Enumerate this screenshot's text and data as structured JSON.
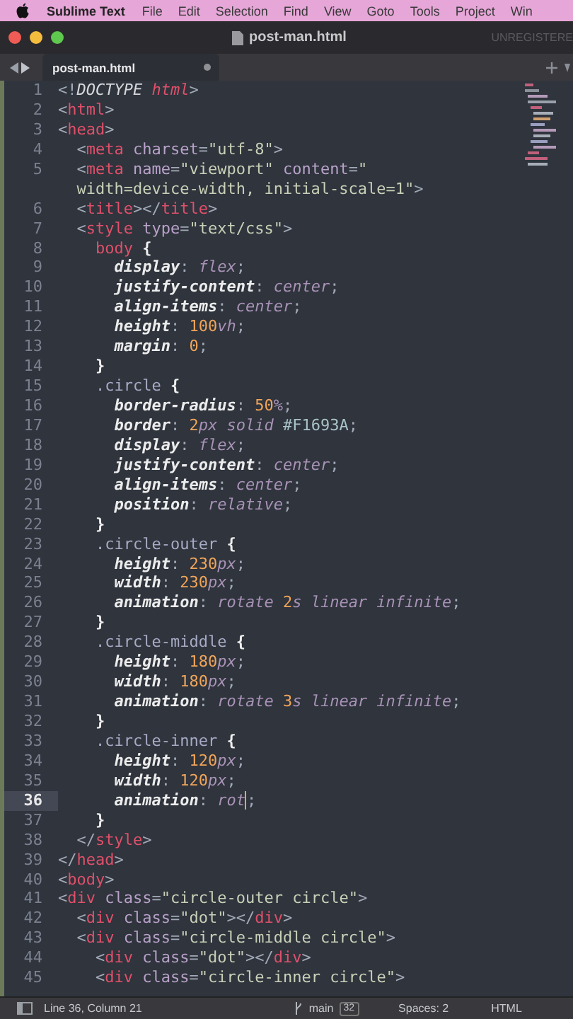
{
  "menu_bar": {
    "app": "Sublime Text",
    "items": [
      "File",
      "Edit",
      "Selection",
      "Find",
      "View",
      "Goto",
      "Tools",
      "Project",
      "Win"
    ]
  },
  "window": {
    "title": "post-man.html",
    "registration": "UNREGISTERE"
  },
  "tabs": [
    {
      "label": "post-man.html",
      "selected": true,
      "modified": true
    }
  ],
  "lines": [
    {
      "number": "1",
      "current": false,
      "tokens": [
        {
          "kind": "punct",
          "text": "<!"
        },
        {
          "kind": "doctype",
          "text": "DOCTYPE "
        },
        {
          "kind": "tag_italic",
          "text": "html"
        },
        {
          "kind": "punct",
          "text": ">"
        }
      ]
    },
    {
      "number": "2",
      "current": false,
      "tokens": [
        {
          "kind": "punct",
          "text": "<"
        },
        {
          "kind": "tag",
          "text": "html"
        },
        {
          "kind": "punct",
          "text": ">"
        }
      ]
    },
    {
      "number": "3",
      "current": false,
      "tokens": [
        {
          "kind": "punct",
          "text": "<"
        },
        {
          "kind": "tag",
          "text": "head"
        },
        {
          "kind": "punct",
          "text": ">"
        }
      ]
    },
    {
      "number": "4",
      "current": false,
      "tokens": [
        {
          "kind": "punct",
          "text": "  <"
        },
        {
          "kind": "tag",
          "text": "meta"
        },
        {
          "kind": "attr",
          "text": " charset"
        },
        {
          "kind": "punct",
          "text": "="
        },
        {
          "kind": "string",
          "text": "\"utf-8\""
        },
        {
          "kind": "punct",
          "text": ">"
        }
      ]
    },
    {
      "number": "5",
      "current": false,
      "tokens": [
        {
          "kind": "punct",
          "text": "  <"
        },
        {
          "kind": "tag",
          "text": "meta"
        },
        {
          "kind": "attr",
          "text": " name"
        },
        {
          "kind": "punct",
          "text": "="
        },
        {
          "kind": "string",
          "text": "\"viewport\""
        },
        {
          "kind": "attr",
          "text": " content"
        },
        {
          "kind": "punct",
          "text": "="
        },
        {
          "kind": "string",
          "text": "\""
        }
      ]
    },
    {
      "current": false,
      "tokens": [
        {
          "kind": "string",
          "text": "  width=device-width, initial-scale=1\""
        },
        {
          "kind": "punct",
          "text": ">"
        }
      ]
    },
    {
      "number": "6",
      "current": false,
      "tokens": [
        {
          "kind": "punct",
          "text": "  <"
        },
        {
          "kind": "tag",
          "text": "title"
        },
        {
          "kind": "punct",
          "text": "></"
        },
        {
          "kind": "tag",
          "text": "title"
        },
        {
          "kind": "punct",
          "text": ">"
        }
      ]
    },
    {
      "number": "7",
      "current": false,
      "tokens": [
        {
          "kind": "punct",
          "text": "  <"
        },
        {
          "kind": "tag",
          "text": "style"
        },
        {
          "kind": "attr",
          "text": " type"
        },
        {
          "kind": "punct",
          "text": "="
        },
        {
          "kind": "string",
          "text": "\"text/css\""
        },
        {
          "kind": "punct",
          "text": ">"
        }
      ]
    },
    {
      "number": "8",
      "current": false,
      "tokens": [
        {
          "kind": "tag",
          "text": "    body"
        },
        {
          "kind": "brace",
          "text": " {"
        }
      ]
    },
    {
      "number": "9",
      "current": false,
      "tokens": [
        {
          "kind": "property",
          "text": "      display"
        },
        {
          "kind": "punct",
          "text": ": "
        },
        {
          "kind": "value",
          "text": "flex"
        },
        {
          "kind": "punct",
          "text": ";"
        }
      ]
    },
    {
      "number": "10",
      "current": false,
      "tokens": [
        {
          "kind": "property",
          "text": "      justify-content"
        },
        {
          "kind": "punct",
          "text": ": "
        },
        {
          "kind": "value",
          "text": "center"
        },
        {
          "kind": "punct",
          "text": ";"
        }
      ]
    },
    {
      "number": "11",
      "current": false,
      "tokens": [
        {
          "kind": "property",
          "text": "      align-items"
        },
        {
          "kind": "punct",
          "text": ": "
        },
        {
          "kind": "value",
          "text": "center"
        },
        {
          "kind": "punct",
          "text": ";"
        }
      ]
    },
    {
      "number": "12",
      "current": false,
      "tokens": [
        {
          "kind": "property",
          "text": "      height"
        },
        {
          "kind": "punct",
          "text": ": "
        },
        {
          "kind": "number",
          "text": "100"
        },
        {
          "kind": "value",
          "text": "vh"
        },
        {
          "kind": "punct",
          "text": ";"
        }
      ]
    },
    {
      "number": "13",
      "current": false,
      "tokens": [
        {
          "kind": "property",
          "text": "      margin"
        },
        {
          "kind": "punct",
          "text": ": "
        },
        {
          "kind": "number",
          "text": "0"
        },
        {
          "kind": "punct",
          "text": ";"
        }
      ]
    },
    {
      "number": "14",
      "current": false,
      "tokens": [
        {
          "kind": "brace",
          "text": "    }"
        }
      ]
    },
    {
      "number": "15",
      "current": false,
      "tokens": [
        {
          "kind": "selector",
          "text": "    .circle"
        },
        {
          "kind": "brace",
          "text": " {"
        }
      ]
    },
    {
      "number": "16",
      "current": false,
      "tokens": [
        {
          "kind": "property",
          "text": "      border-radius"
        },
        {
          "kind": "punct",
          "text": ": "
        },
        {
          "kind": "number",
          "text": "50"
        },
        {
          "kind": "value",
          "text": "%"
        },
        {
          "kind": "punct",
          "text": ";"
        }
      ]
    },
    {
      "number": "17",
      "current": false,
      "tokens": [
        {
          "kind": "property",
          "text": "      border"
        },
        {
          "kind": "punct",
          "text": ": "
        },
        {
          "kind": "number",
          "text": "2"
        },
        {
          "kind": "value",
          "text": "px solid "
        },
        {
          "kind": "hex",
          "text": "#F1693A"
        },
        {
          "kind": "punct",
          "text": ";"
        }
      ]
    },
    {
      "number": "18",
      "current": false,
      "tokens": [
        {
          "kind": "property",
          "text": "      display"
        },
        {
          "kind": "punct",
          "text": ": "
        },
        {
          "kind": "value",
          "text": "flex"
        },
        {
          "kind": "punct",
          "text": ";"
        }
      ]
    },
    {
      "number": "19",
      "current": false,
      "tokens": [
        {
          "kind": "property",
          "text": "      justify-content"
        },
        {
          "kind": "punct",
          "text": ": "
        },
        {
          "kind": "value",
          "text": "center"
        },
        {
          "kind": "punct",
          "text": ";"
        }
      ]
    },
    {
      "number": "20",
      "current": false,
      "tokens": [
        {
          "kind": "property",
          "text": "      align-items"
        },
        {
          "kind": "punct",
          "text": ": "
        },
        {
          "kind": "value",
          "text": "center"
        },
        {
          "kind": "punct",
          "text": ";"
        }
      ]
    },
    {
      "number": "21",
      "current": false,
      "tokens": [
        {
          "kind": "property",
          "text": "      position"
        },
        {
          "kind": "punct",
          "text": ": "
        },
        {
          "kind": "value",
          "text": "relative"
        },
        {
          "kind": "punct",
          "text": ";"
        }
      ]
    },
    {
      "number": "22",
      "current": false,
      "tokens": [
        {
          "kind": "brace",
          "text": "    }"
        }
      ]
    },
    {
      "number": "23",
      "current": false,
      "tokens": [
        {
          "kind": "selector",
          "text": "    .circle-outer"
        },
        {
          "kind": "brace",
          "text": " {"
        }
      ]
    },
    {
      "number": "24",
      "current": false,
      "tokens": [
        {
          "kind": "property",
          "text": "      height"
        },
        {
          "kind": "punct",
          "text": ": "
        },
        {
          "kind": "number",
          "text": "230"
        },
        {
          "kind": "value",
          "text": "px"
        },
        {
          "kind": "punct",
          "text": ";"
        }
      ]
    },
    {
      "number": "25",
      "current": false,
      "tokens": [
        {
          "kind": "property",
          "text": "      width"
        },
        {
          "kind": "punct",
          "text": ": "
        },
        {
          "kind": "number",
          "text": "230"
        },
        {
          "kind": "value",
          "text": "px"
        },
        {
          "kind": "punct",
          "text": ";"
        }
      ]
    },
    {
      "number": "26",
      "current": false,
      "tokens": [
        {
          "kind": "property",
          "text": "      animation"
        },
        {
          "kind": "punct",
          "text": ": "
        },
        {
          "kind": "value",
          "text": "rotate "
        },
        {
          "kind": "number",
          "text": "2"
        },
        {
          "kind": "value",
          "text": "s linear infinite"
        },
        {
          "kind": "punct",
          "text": ";"
        }
      ]
    },
    {
      "number": "27",
      "current": false,
      "tokens": [
        {
          "kind": "brace",
          "text": "    }"
        }
      ]
    },
    {
      "number": "28",
      "current": false,
      "tokens": [
        {
          "kind": "selector",
          "text": "    .circle-middle"
        },
        {
          "kind": "brace",
          "text": " {"
        }
      ]
    },
    {
      "number": "29",
      "current": false,
      "tokens": [
        {
          "kind": "property",
          "text": "      height"
        },
        {
          "kind": "punct",
          "text": ": "
        },
        {
          "kind": "number",
          "text": "180"
        },
        {
          "kind": "value",
          "text": "px"
        },
        {
          "kind": "punct",
          "text": ";"
        }
      ]
    },
    {
      "number": "30",
      "current": false,
      "tokens": [
        {
          "kind": "property",
          "text": "      width"
        },
        {
          "kind": "punct",
          "text": ": "
        },
        {
          "kind": "number",
          "text": "180"
        },
        {
          "kind": "value",
          "text": "px"
        },
        {
          "kind": "punct",
          "text": ";"
        }
      ]
    },
    {
      "number": "31",
      "current": false,
      "tokens": [
        {
          "kind": "property",
          "text": "      animation"
        },
        {
          "kind": "punct",
          "text": ": "
        },
        {
          "kind": "value",
          "text": "rotate "
        },
        {
          "kind": "number",
          "text": "3"
        },
        {
          "kind": "value",
          "text": "s linear infinite"
        },
        {
          "kind": "punct",
          "text": ";"
        }
      ]
    },
    {
      "number": "32",
      "current": false,
      "tokens": [
        {
          "kind": "brace",
          "text": "    }"
        }
      ]
    },
    {
      "number": "33",
      "current": false,
      "tokens": [
        {
          "kind": "selector",
          "text": "    .circle-inner"
        },
        {
          "kind": "brace",
          "text": " {"
        }
      ]
    },
    {
      "number": "34",
      "current": false,
      "tokens": [
        {
          "kind": "property",
          "text": "      height"
        },
        {
          "kind": "punct",
          "text": ": "
        },
        {
          "kind": "number",
          "text": "120"
        },
        {
          "kind": "value",
          "text": "px"
        },
        {
          "kind": "punct",
          "text": ";"
        }
      ]
    },
    {
      "number": "35",
      "current": false,
      "tokens": [
        {
          "kind": "property",
          "text": "      width"
        },
        {
          "kind": "punct",
          "text": ": "
        },
        {
          "kind": "number",
          "text": "120"
        },
        {
          "kind": "value",
          "text": "px"
        },
        {
          "kind": "punct",
          "text": ";"
        }
      ]
    },
    {
      "number": "36",
      "current": true,
      "tokens": [
        {
          "kind": "property",
          "text": "      animation"
        },
        {
          "kind": "punct",
          "text": ": "
        },
        {
          "kind": "value",
          "text": "rot",
          "caret": true
        },
        {
          "kind": "punct",
          "text": ";"
        }
      ]
    },
    {
      "number": "37",
      "current": false,
      "tokens": [
        {
          "kind": "brace",
          "text": "    }"
        }
      ]
    },
    {
      "number": "38",
      "current": false,
      "tokens": [
        {
          "kind": "punct",
          "text": "  </"
        },
        {
          "kind": "tag",
          "text": "style"
        },
        {
          "kind": "punct",
          "text": ">"
        }
      ]
    },
    {
      "number": "39",
      "current": false,
      "tokens": [
        {
          "kind": "punct",
          "text": "</"
        },
        {
          "kind": "tag",
          "text": "head"
        },
        {
          "kind": "punct",
          "text": ">"
        }
      ]
    },
    {
      "number": "40",
      "current": false,
      "tokens": [
        {
          "kind": "punct",
          "text": "<"
        },
        {
          "kind": "tag",
          "text": "body"
        },
        {
          "kind": "punct",
          "text": ">"
        }
      ]
    },
    {
      "number": "41",
      "current": false,
      "tokens": [
        {
          "kind": "punct",
          "text": "<"
        },
        {
          "kind": "tag",
          "text": "div"
        },
        {
          "kind": "attr",
          "text": " class"
        },
        {
          "kind": "punct",
          "text": "="
        },
        {
          "kind": "string",
          "text": "\"circle-outer circle\""
        },
        {
          "kind": "punct",
          "text": ">"
        }
      ]
    },
    {
      "number": "42",
      "current": false,
      "tokens": [
        {
          "kind": "punct",
          "text": "  <"
        },
        {
          "kind": "tag",
          "text": "div"
        },
        {
          "kind": "attr",
          "text": " class"
        },
        {
          "kind": "punct",
          "text": "="
        },
        {
          "kind": "string",
          "text": "\"dot\""
        },
        {
          "kind": "punct",
          "text": "></"
        },
        {
          "kind": "tag",
          "text": "div"
        },
        {
          "kind": "punct",
          "text": ">"
        }
      ]
    },
    {
      "number": "43",
      "current": false,
      "tokens": [
        {
          "kind": "punct",
          "text": "  <"
        },
        {
          "kind": "tag",
          "text": "div"
        },
        {
          "kind": "attr",
          "text": " class"
        },
        {
          "kind": "punct",
          "text": "="
        },
        {
          "kind": "string",
          "text": "\"circle-middle circle\""
        },
        {
          "kind": "punct",
          "text": ">"
        }
      ]
    },
    {
      "number": "44",
      "current": false,
      "tokens": [
        {
          "kind": "punct",
          "text": "    <"
        },
        {
          "kind": "tag",
          "text": "div"
        },
        {
          "kind": "attr",
          "text": " class"
        },
        {
          "kind": "punct",
          "text": "="
        },
        {
          "kind": "string",
          "text": "\"dot\""
        },
        {
          "kind": "punct",
          "text": "></"
        },
        {
          "kind": "tag",
          "text": "div"
        },
        {
          "kind": "punct",
          "text": ">"
        }
      ]
    },
    {
      "number": "45",
      "current": false,
      "tokens": [
        {
          "kind": "punct",
          "text": "    <"
        },
        {
          "kind": "tag",
          "text": "div"
        },
        {
          "kind": "attr",
          "text": " class"
        },
        {
          "kind": "punct",
          "text": "="
        },
        {
          "kind": "string",
          "text": "\"circle-inner circle\""
        },
        {
          "kind": "punct",
          "text": ">"
        }
      ]
    }
  ],
  "status_bar": {
    "position": "Line 36, Column 21",
    "branch": "main",
    "changes": "32",
    "indentation": "Spaces: 2",
    "syntax": "HTML"
  }
}
